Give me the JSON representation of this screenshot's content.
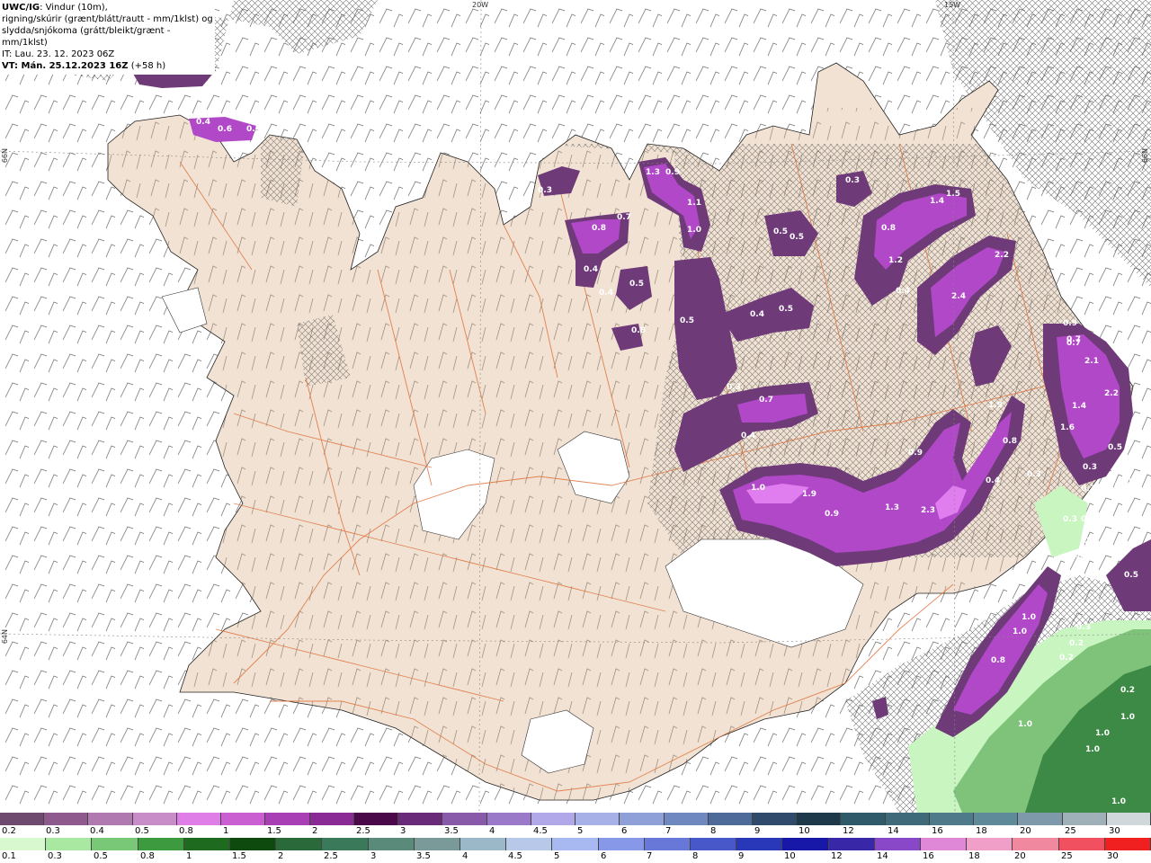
{
  "header": {
    "product_code": "UWC/IG",
    "line1_rest": ": Vindur (10m),",
    "line2": "rigning/skúrir (grænt/blátt/rautt - mm/1klst) og",
    "line3": "slydda/snjókoma (grátt/bleikt/grænt - mm/1klst)",
    "line4": "IT: Lau. 23. 12. 2023 06Z",
    "vt_label": "VT: Mán. 25.12.2023 16Z",
    "vt_offset": "(+58 h)"
  },
  "grid_labels": {
    "lon_20w": "20W",
    "lon_15w": "15W",
    "lat_66n_left": "66N",
    "lat_66n_right": "66N",
    "lat_64n_left": "64N"
  },
  "colors": {
    "land": "#f1e2d3",
    "road": "#e0703a",
    "glacier": "#ffffff",
    "snow_dark": "#6e3a78",
    "snow_mid": "#b048c8",
    "snow_light": "#e07ef0",
    "rain_green_light": "#c8f5c0",
    "rain_green_mid": "#6bb46b",
    "rain_green_dark": "#2f7d3a"
  },
  "legend_snow": {
    "labels": [
      "0.2",
      "0.3",
      "0.4",
      "0.5",
      "0.8",
      "1",
      "1.5",
      "2",
      "2.5",
      "3",
      "3.5",
      "4",
      "4.5",
      "5",
      "6",
      "7",
      "8",
      "9",
      "10",
      "12",
      "14",
      "16",
      "18",
      "20",
      "25",
      "30"
    ],
    "colors": [
      "#6e4a6e",
      "#8e5a8e",
      "#b07ab0",
      "#c88cc8",
      "#e07ee8",
      "#c95fd0",
      "#a83fb5",
      "#8a2a95",
      "#4a0a4a",
      "#6a2a7a",
      "#8a5aaa",
      "#9a7ac8",
      "#b0a8e8",
      "#a8b0e8",
      "#8fa0d8",
      "#6f88c0",
      "#4e6a98",
      "#2f4a6a",
      "#1e3a4a",
      "#2e5a6a",
      "#3e6a7a",
      "#4e7a8a",
      "#5e8a9a",
      "#7e9aaa",
      "#a0b0b8",
      "#d0d8dc"
    ]
  },
  "legend_rain": {
    "labels": [
      "0.1",
      "0.3",
      "0.5",
      "0.8",
      "1",
      "1.5",
      "2",
      "2.5",
      "3",
      "3.5",
      "4",
      "4.5",
      "5",
      "6",
      "7",
      "8",
      "9",
      "10",
      "12",
      "14",
      "16",
      "18",
      "20",
      "25",
      "30"
    ],
    "colors": [
      "#d8f8d0",
      "#a8e8a0",
      "#78c878",
      "#3e9a3e",
      "#1e6a1e",
      "#0e4a0e",
      "#2a6a3a",
      "#3a7a5a",
      "#5a8a7a",
      "#7a9a9a",
      "#9ab8c8",
      "#b8c8e8",
      "#a8b8f0",
      "#8898e8",
      "#6878d8",
      "#4858c8",
      "#2838b8",
      "#1818a8",
      "#3828a8",
      "#8848c8",
      "#e088d8",
      "#f0a0c8",
      "#f088a0",
      "#f05060",
      "#f02020"
    ]
  },
  "precip_labels": [
    {
      "v": "0.3"
    },
    {
      "v": "0.4"
    },
    {
      "v": "0.6"
    },
    {
      "v": "0.5"
    },
    {
      "v": "0.3"
    },
    {
      "v": "1.3"
    },
    {
      "v": "0.9"
    },
    {
      "v": "1.1"
    },
    {
      "v": "1.0"
    },
    {
      "v": "0.7"
    },
    {
      "v": "0.8"
    },
    {
      "v": "0.4"
    },
    {
      "v": "0.5"
    },
    {
      "v": "0.4"
    },
    {
      "v": "0.5"
    },
    {
      "v": "0.4"
    },
    {
      "v": "0.5"
    },
    {
      "v": "0.5"
    },
    {
      "v": "0.3"
    },
    {
      "v": "0.5"
    },
    {
      "v": "0.8"
    },
    {
      "v": "1.4"
    },
    {
      "v": "1.5"
    },
    {
      "v": "1.2"
    },
    {
      "v": "0.4"
    },
    {
      "v": "2.2"
    },
    {
      "v": "2.4"
    },
    {
      "v": "0.9"
    },
    {
      "v": "0.7"
    },
    {
      "v": "2.1"
    },
    {
      "v": "2.2"
    },
    {
      "v": "1.4"
    },
    {
      "v": "1.6"
    },
    {
      "v": "0.5"
    },
    {
      "v": "0.4"
    },
    {
      "v": "0.3"
    },
    {
      "v": "0.7"
    },
    {
      "v": "0.8"
    },
    {
      "v": "0.3"
    },
    {
      "v": "0.4"
    },
    {
      "v": "0.7"
    },
    {
      "v": "1.0"
    },
    {
      "v": "1.9"
    },
    {
      "v": "0.9"
    },
    {
      "v": "1.3"
    },
    {
      "v": "2.3"
    },
    {
      "v": "0.9"
    },
    {
      "v": "1.9"
    },
    {
      "v": "0.8"
    },
    {
      "v": "0.4"
    },
    {
      "v": "0.3"
    },
    {
      "v": "0.3"
    },
    {
      "v": "0.3"
    },
    {
      "v": "0.3"
    },
    {
      "v": "0.3"
    },
    {
      "v": "0.4"
    },
    {
      "v": "0.3"
    },
    {
      "v": "0.3"
    },
    {
      "v": "0.5"
    },
    {
      "v": "1.0"
    },
    {
      "v": "1.0"
    },
    {
      "v": "0.3"
    },
    {
      "v": "0.2"
    },
    {
      "v": "0.2"
    },
    {
      "v": "0.8"
    },
    {
      "v": "1.0"
    },
    {
      "v": "1.0"
    },
    {
      "v": "1.0"
    },
    {
      "v": "0.2"
    },
    {
      "v": "1.0"
    },
    {
      "v": "1.0"
    }
  ]
}
